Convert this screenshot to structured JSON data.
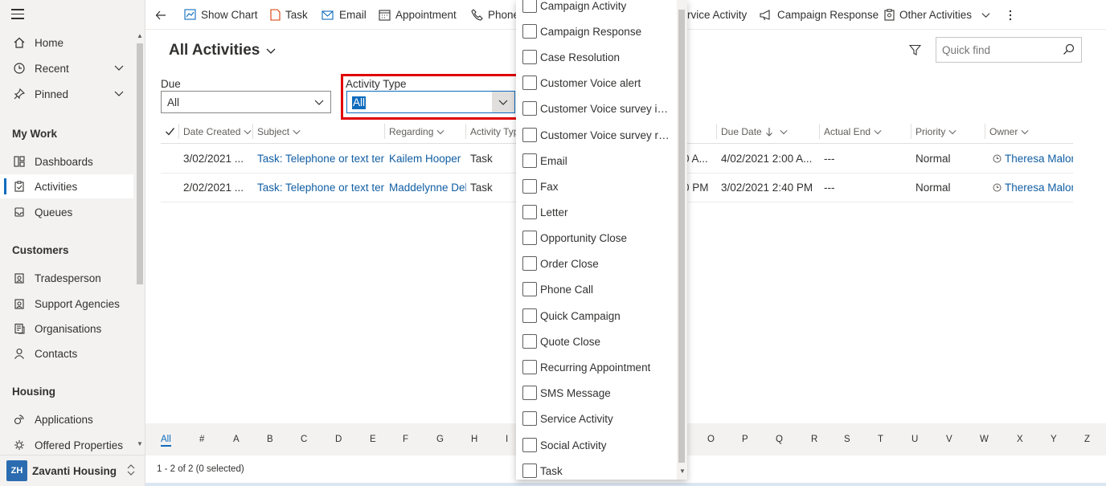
{
  "sidebar": {
    "nav": [
      {
        "label": "Home",
        "icon": "home-icon"
      },
      {
        "label": "Recent",
        "icon": "clock-icon"
      },
      {
        "label": "Pinned",
        "icon": "pin-icon"
      }
    ],
    "sections": [
      {
        "title": "My Work",
        "items": [
          "Dashboards",
          "Activities",
          "Queues"
        ]
      },
      {
        "title": "Customers",
        "items": [
          "Tradesperson",
          "Support Agencies",
          "Organisations",
          "Contacts"
        ]
      },
      {
        "title": "Housing",
        "items": [
          "Applications",
          "Offered Properties"
        ]
      }
    ],
    "active_item": "Activities",
    "footer": {
      "initials": "ZH",
      "name": "Zavanti Housing",
      "accent": "#2b6cb0"
    }
  },
  "commandbar": {
    "items": [
      "Show Chart",
      "Task",
      "Email",
      "Appointment",
      "Phone",
      "rvice Activity",
      "Campaign Response",
      "Other Activities"
    ]
  },
  "view": {
    "title": "All Activities"
  },
  "quickfind": {
    "placeholder": "Quick find"
  },
  "filters": {
    "due": {
      "label": "Due",
      "value": "All"
    },
    "activity_type": {
      "label": "Activity Type",
      "value": "All"
    }
  },
  "grid": {
    "columns": [
      "Date Created",
      "Subject",
      "Regarding",
      "Activity Type",
      "Due Date",
      "Actual End",
      "Priority",
      "Owner"
    ],
    "rows": [
      {
        "date_created": "3/02/2021 ...",
        "subject": "Task: Telephone or text tenar",
        "regarding": "Kailem Hooper",
        "activity_type": "Task",
        "partial": "0 A...",
        "due_date": "4/02/2021 2:00 A...",
        "actual_end": "---",
        "priority": "Normal",
        "owner": "Theresa Malone"
      },
      {
        "date_created": "2/02/2021 ...",
        "subject": "Task: Telephone or text tenar",
        "regarding": "Maddelynne Deb",
        "activity_type": "Task",
        "partial": "0 PM",
        "due_date": "3/02/2021 2:40 PM",
        "actual_end": "---",
        "priority": "Normal",
        "owner": "Theresa Malone"
      }
    ]
  },
  "alphabet": [
    "All",
    "#",
    "A",
    "B",
    "C",
    "D",
    "E",
    "F",
    "G",
    "H",
    "I",
    "O",
    "P",
    "Q",
    "R",
    "S",
    "T",
    "U",
    "V",
    "W",
    "X",
    "Y",
    "Z"
  ],
  "status": "1 - 2 of 2 (0 selected)",
  "dropdown_options": [
    "Campaign Activity",
    "Campaign Response",
    "Case Resolution",
    "Customer Voice alert",
    "Customer Voice survey invite",
    "Customer Voice survey res...",
    "Email",
    "Fax",
    "Letter",
    "Opportunity Close",
    "Order Close",
    "Phone Call",
    "Quick Campaign",
    "Quote Close",
    "Recurring Appointment",
    "SMS Message",
    "Service Activity",
    "Social Activity",
    "Task"
  ],
  "colors": {
    "accent": "#0f6cbd",
    "link": "#115ea3",
    "highlight": "#e00000"
  }
}
